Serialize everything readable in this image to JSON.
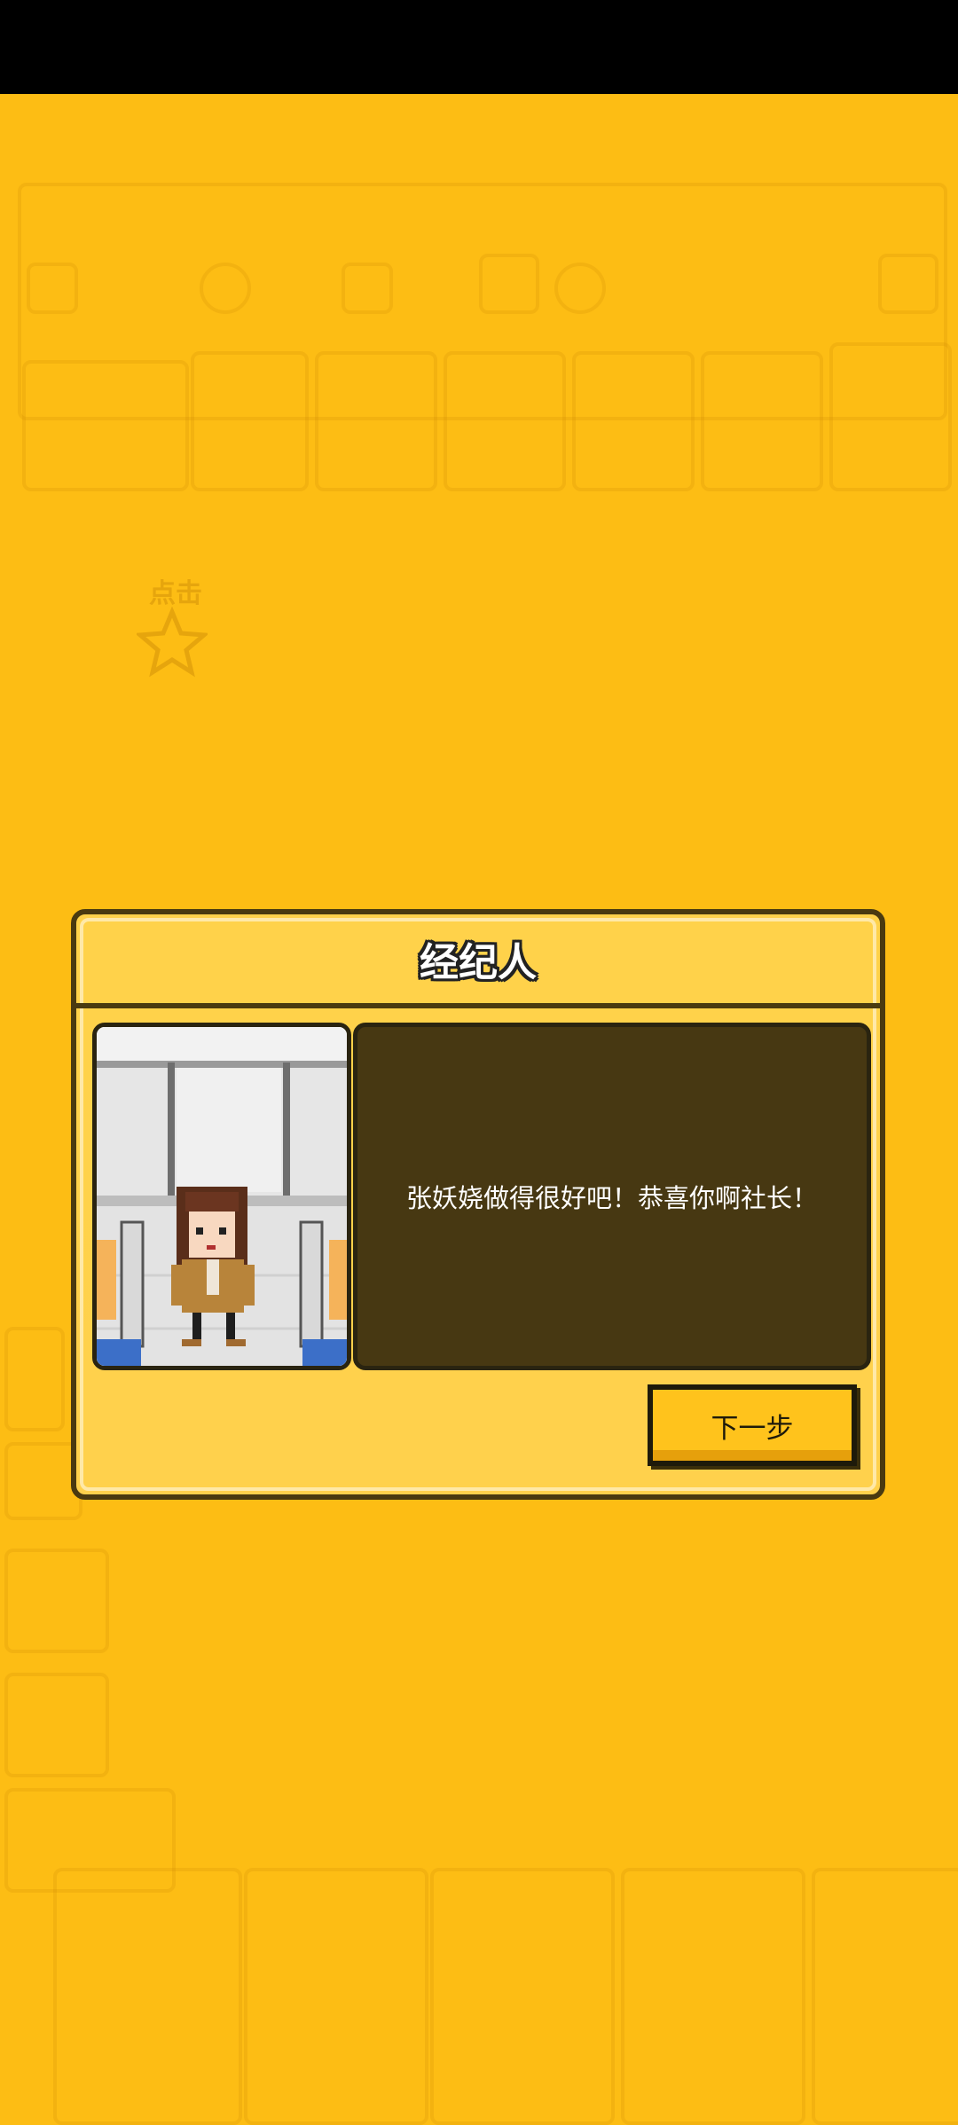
{
  "dialog": {
    "title": "经纪人",
    "message": "张妖娆做得很好吧！恭喜你啊社长！",
    "next_button": "下一步"
  },
  "background": {
    "tap_hint": "点击"
  },
  "colors": {
    "background": "#FDBD14",
    "dialog_fill": "#FFD24A",
    "speech_fill": "#473812",
    "border": "#4A3A10"
  }
}
